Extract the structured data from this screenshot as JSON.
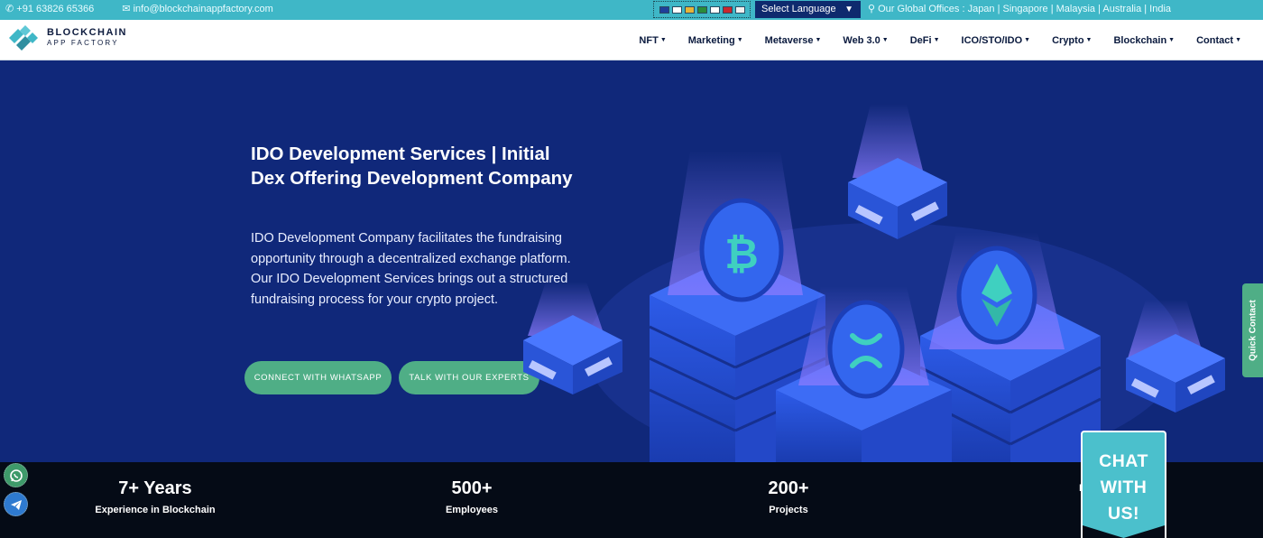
{
  "topbar": {
    "phone": "+91 63826 65366",
    "email": "info@blockchainappfactory.com",
    "language_label": "Select Language",
    "offices": "Our Global Offices : Japan | Singapore | Malaysia | Australia | India",
    "flag_colors": [
      "#1f3f9a",
      "#ffffff",
      "#e6b43a",
      "#2a8c3a",
      "#ffffff",
      "#c8282e",
      "#f0f0f0"
    ]
  },
  "brand": {
    "line1": "BLOCKCHAIN",
    "line2": "APP FACTORY"
  },
  "nav": [
    {
      "label": "NFT",
      "name": "nav-nft"
    },
    {
      "label": "Marketing",
      "name": "nav-marketing"
    },
    {
      "label": "Metaverse",
      "name": "nav-metaverse"
    },
    {
      "label": "Web 3.0",
      "name": "nav-web3"
    },
    {
      "label": "DeFi",
      "name": "nav-defi"
    },
    {
      "label": "ICO/STO/IDO",
      "name": "nav-ico-sto-ido"
    },
    {
      "label": "Crypto",
      "name": "nav-crypto"
    },
    {
      "label": "Blockchain",
      "name": "nav-blockchain"
    },
    {
      "label": "Contact",
      "name": "nav-contact"
    }
  ],
  "hero": {
    "title": "IDO Development Services | Initial Dex Offering Development Company",
    "description": "IDO Development Company facilitates the fundraising opportunity through a decentralized exchange platform. Our IDO Development Services brings out a structured fundraising process for your crypto project.",
    "cta_whatsapp": "CONNECT WITH WHATSAPP",
    "cta_experts": "TALK WITH OUR EXPERTS",
    "icon_bitcoin": "bitcoin-icon",
    "icon_ripple": "ripple-icon",
    "icon_ethereum": "ethereum-icon"
  },
  "quick_contact": "Quick Contact",
  "stats": [
    {
      "value": "7+ Years",
      "label": "Experience in Blockchain"
    },
    {
      "value": "500+",
      "label": "Employees"
    },
    {
      "value": "200+",
      "label": "Projects"
    },
    {
      "value": "",
      "label": "Bloc"
    }
  ],
  "chat": {
    "line1": "CHAT",
    "line2": "WITH",
    "line3": "US!"
  },
  "colors": {
    "topbar": "#3fb7c7",
    "hero_bg": "#10287a",
    "button_green": "#4fae86",
    "stats_bg": "#050b16",
    "chat_bg": "#4bc0cc"
  }
}
